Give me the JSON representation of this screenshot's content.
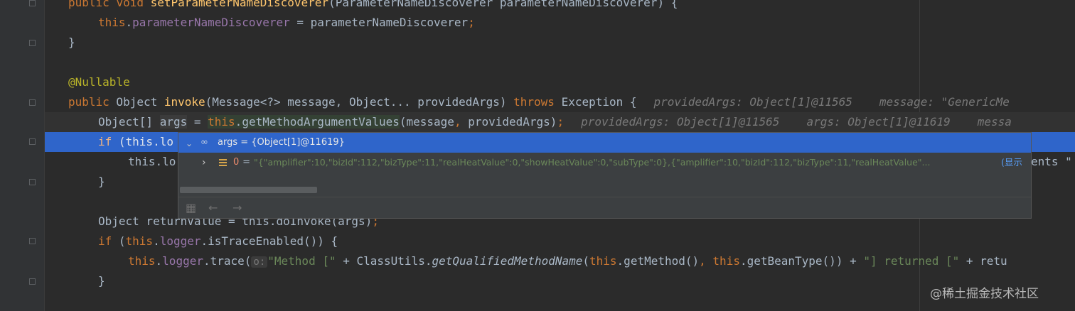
{
  "code": {
    "l0": {
      "kw1": "public",
      "kw2": "void",
      "fn": "setParameterNameDiscoverer",
      "rest": "(ParameterNameDiscoverer parameterNameDiscoverer) {"
    },
    "l1": {
      "this": "this",
      "dot": ".",
      "field": "parameterNameDiscoverer",
      "rest": " = parameterNameDiscoverer",
      "semi": ";"
    },
    "l2": {
      "text": "}"
    },
    "l4": {
      "text": "@Nullable"
    },
    "l5": {
      "kw": "public",
      "mid": " Object ",
      "fn": "invoke",
      "params": "(Message<?> message, Object... providedArgs) ",
      "throws": "throws",
      "rest": " Exception {",
      "hint1": "providedArgs: Object[1]@11565",
      "hint2": "message: \"GenericMe"
    },
    "l6": {
      "pre": "Object[] ",
      "var": "args",
      "eq": " = ",
      "this": "this",
      "dot": ".",
      "call": "getMethodArgumentValues",
      "p1": "(message",
      "comma": ",",
      "p2": " providedArgs)",
      "semi": ";",
      "hint1": "providedArgs: Object[1]@11565",
      "hint2": "args: Object[1]@11619",
      "hint3": "messa"
    },
    "l7": {
      "kw": "if",
      "rest": " (this.lo"
    },
    "l8": {
      "pre": "this.lo",
      "tail": "ents \""
    },
    "l9": {
      "text": "}"
    },
    "l11": {
      "pre": "Object returnValue = this.doInvoke(args)",
      "semi": ";"
    },
    "l12": {
      "kw": "if",
      "open": " (",
      "this": "this",
      "dot": ".",
      "field": "logger",
      "rest": ".isTraceEnabled()) {"
    },
    "l13": {
      "this": "this",
      "dot": ".",
      "field": "logger",
      "call": ".trace(",
      "inlay": "o:",
      "str1": "\"Method [\"",
      "plus1": " + ClassUtils.",
      "static": "getQualifiedMethodName",
      "open": "(",
      "this2": "this",
      "m1": ".getMethod()",
      "comma": ",",
      "sp": " ",
      "this3": "this",
      "m2": ".getBeanType())",
      "plus2": " + ",
      "str2": "\"] returned [\"",
      "plus3": " + retu"
    },
    "l14": {
      "text": "}"
    }
  },
  "debug_popup": {
    "root_icon": "watch-glasses-icon",
    "root_label": "args = {Object[1]@11619}",
    "child_index": "0",
    "child_eq": " = ",
    "child_value": "\"{\"amplifier\":10,\"bizId\":112,\"bizType\":11,\"realHeatValue\":0,\"showHeatValue\":0,\"subType\":0},{\"amplifier\":10,\"bizId\":112,\"bizType\":11,\"realHeatValue\"...",
    "show_link": "(显示"
  },
  "watermark": "@稀土掘金技术社区",
  "colors": {
    "background": "#2b2b2b",
    "keyword": "#cc7832",
    "method": "#ffc66d",
    "field": "#9876aa",
    "string": "#6a8759",
    "annotation": "#bbb529",
    "selection": "#2f65ca"
  }
}
